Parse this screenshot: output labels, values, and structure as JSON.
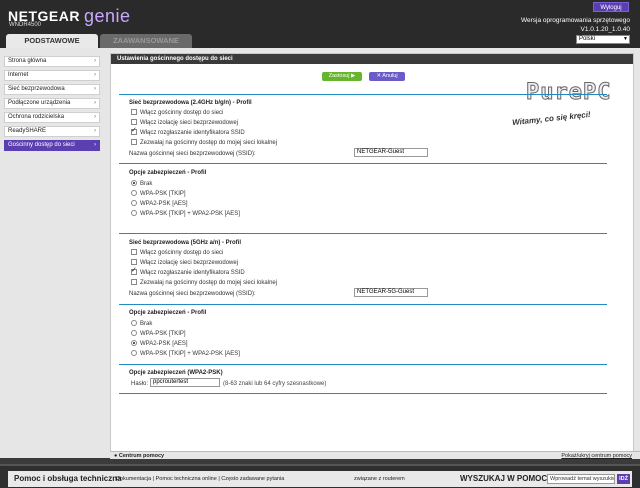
{
  "header": {
    "brand": "NETGEAR",
    "product": "genie",
    "model": "WNDR4500",
    "logout_label": "Wyloguj",
    "firmware_label": "Wersja oprogramowania sprzętowego",
    "firmware_value": "V1.0.1.20_1.0.40"
  },
  "tabs": [
    {
      "label": "PODSTAWOWE",
      "active": true
    },
    {
      "label": "ZAAWANSOWANE",
      "active": false
    }
  ],
  "language": {
    "selected": "Polski"
  },
  "sidebar": {
    "items": [
      {
        "label": "Strona główna"
      },
      {
        "label": "Internet"
      },
      {
        "label": "Sieć bezprzewodowa"
      },
      {
        "label": "Podłączone urządzenia"
      },
      {
        "label": "Ochrona rodzicielska"
      },
      {
        "label": "ReadySHARE"
      },
      {
        "label": "Gościnny dostęp do sieci",
        "active": true
      }
    ]
  },
  "panel": {
    "title": "Ustawienia gościnnego dostępu do sieci",
    "apply_label": "Zastosuj ▶",
    "cancel_label": "✕ Anuluj",
    "watermark": {
      "logo": "PurePC",
      "slogan": "Witamy, co się kręci!"
    }
  },
  "wifi24": {
    "title": "Sieć bezprzewodowa (2.4GHz b/g/n) - Profil",
    "options": [
      {
        "label": "Włącz gościnny dostęp do sieci",
        "checked": false
      },
      {
        "label": "Włącz izolację sieci bezprzewodowej",
        "checked": false
      },
      {
        "label": "Włącz rozgłaszanie identyfikatora SSID",
        "checked": true
      },
      {
        "label": "Zezwalaj na gościnny dostęp do mojej sieci lokalnej",
        "checked": false
      }
    ],
    "ssid_label": "Nazwa gościnnej sieci bezprzewodowej (SSID):",
    "ssid_value": "NETGEAR-Guest",
    "security_title": "Opcje zabezpieczeń - Profil",
    "security_options": [
      {
        "label": "Brak",
        "selected": true
      },
      {
        "label": "WPA-PSK [TKIP]",
        "selected": false
      },
      {
        "label": "WPA2-PSK [AES]",
        "selected": false
      },
      {
        "label": "WPA-PSK [TKIP] + WPA2-PSK [AES]",
        "selected": false
      }
    ]
  },
  "wifi5": {
    "title": "Sieć bezprzewodowa (5GHz a/n) - Profil",
    "options": [
      {
        "label": "Włącz gościnny dostęp do sieci",
        "checked": false
      },
      {
        "label": "Włącz izolację sieci bezprzewodowej",
        "checked": false
      },
      {
        "label": "Włącz rozgłaszanie identyfikatora SSID",
        "checked": true
      },
      {
        "label": "Zezwalaj na gościnny dostęp do mojej sieci lokalnej",
        "checked": false
      }
    ],
    "ssid_label": "Nazwa gościnnej sieci bezprzewodowej (SSID):",
    "ssid_value": "NETGEAR-5G-Guest",
    "security_title": "Opcje zabezpieczeń - Profil",
    "security_options": [
      {
        "label": "Brak",
        "selected": false
      },
      {
        "label": "WPA-PSK [TKIP]",
        "selected": false
      },
      {
        "label": "WPA2-PSK [AES]",
        "selected": true
      },
      {
        "label": "WPA-PSK [TKIP] + WPA2-PSK [AES]",
        "selected": false
      }
    ]
  },
  "wpa2": {
    "title": "Opcje zabezpieczeń (WPA2-PSK)",
    "password_label": "Hasło:",
    "password_value": "ppcroutertest",
    "password_hint": "(8-63 znaki lub 64 cyfry szesnastkowe)"
  },
  "helpbar": {
    "left": "Centrum pomocy",
    "right": "Pokaż/ukryj centrum pomocy"
  },
  "footer": {
    "title": "Pomoc i obsługa techniczna",
    "links": "Dokumentacja | Pomoc techniczna online | Często zadawane pytania",
    "related": "związane z routerem",
    "search_title": "WYSZUKAJ W POMOCY",
    "search_placeholder": "Wprowadź temat wyszukiwania",
    "search_button": "IDŹ"
  }
}
